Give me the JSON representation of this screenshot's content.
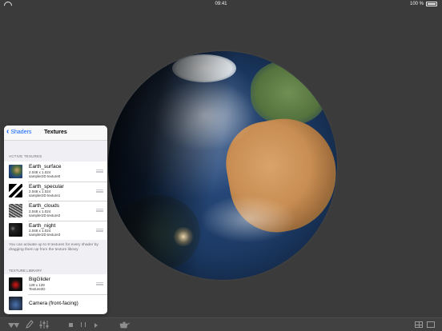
{
  "status_bar": {
    "time": "09:41",
    "battery": "100 %"
  },
  "popover": {
    "back_label": "Shaders",
    "title": "Textures",
    "active_header": "ACTIVE TEXURES",
    "active_textures": [
      {
        "name": "Earth_surface",
        "size": "2.048 x 1.024",
        "binding": "sampler2D texture0",
        "thumb": "t-surface"
      },
      {
        "name": "Earth_specular",
        "size": "2.048 x 1.024",
        "binding": "sampler2D texture1",
        "thumb": "t-specular"
      },
      {
        "name": "Earth_clouds",
        "size": "2.048 x 1.024",
        "binding": "sampler2D texture2",
        "thumb": "t-clouds"
      },
      {
        "name": "Earth_night",
        "size": "2.048 x 1.024",
        "binding": "sampler2D texture3",
        "thumb": "t-night"
      }
    ],
    "note": "You can activate up to 8 textures for every shader by dragging them up from the texture library",
    "library_header": "TEXTURE LIBRARY",
    "library": [
      {
        "name": "BigGlider",
        "size": "128 x 128",
        "binding": "Texture2D",
        "thumb": "t-glider"
      },
      {
        "name": "Camera (front-facing)",
        "size": "",
        "binding": "",
        "thumb": "t-camera"
      }
    ]
  },
  "toolbar": {
    "icons": [
      "shapes-icon",
      "pencil-icon",
      "sliders-icon",
      "stop-icon",
      "pause-icon",
      "play-icon",
      "teapot-icon",
      "grid-layout-icon",
      "single-layout-icon"
    ]
  }
}
